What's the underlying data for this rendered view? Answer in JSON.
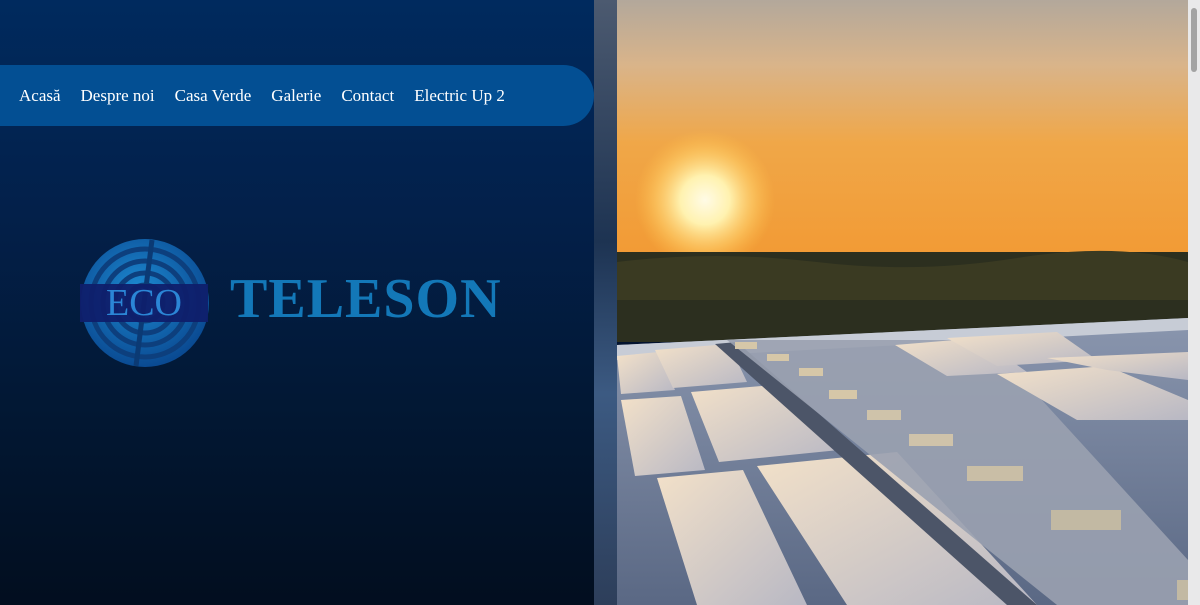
{
  "nav": {
    "items": [
      "Acasă",
      "Despre noi",
      "Casa Verde",
      "Galerie",
      "Contact",
      "Electric Up 2"
    ]
  },
  "logo": {
    "mark_text": "ECO",
    "wordmark": "TELESON"
  },
  "colors": {
    "nav_bar": "#034f93",
    "brand_blue": "#1378b8",
    "background": "#03132e"
  },
  "hero_image": {
    "subject": "solar panels on a rooftop at sunset"
  }
}
